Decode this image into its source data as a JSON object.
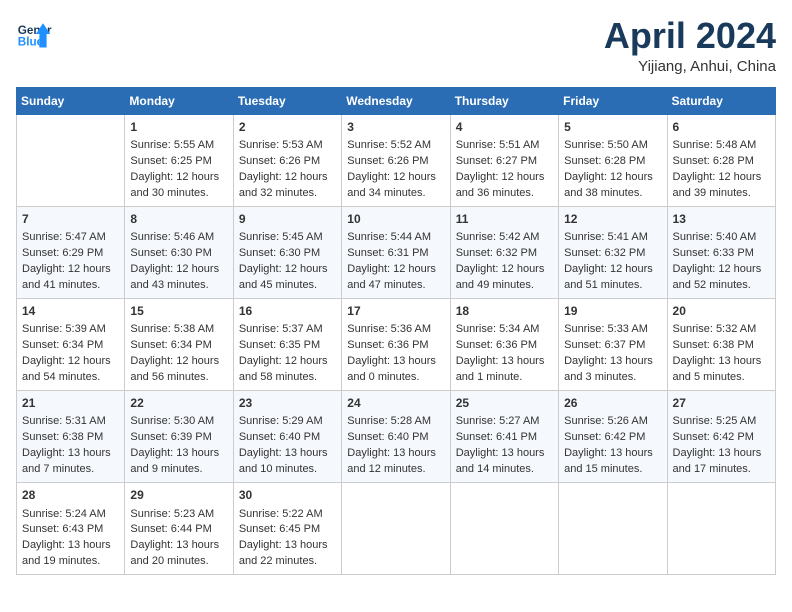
{
  "header": {
    "logo_line1": "General",
    "logo_line2": "Blue",
    "month_title": "April 2024",
    "location": "Yijiang, Anhui, China"
  },
  "days_of_week": [
    "Sunday",
    "Monday",
    "Tuesday",
    "Wednesday",
    "Thursday",
    "Friday",
    "Saturday"
  ],
  "weeks": [
    [
      {
        "day": "",
        "sunrise": "",
        "sunset": "",
        "daylight": ""
      },
      {
        "day": "1",
        "sunrise": "Sunrise: 5:55 AM",
        "sunset": "Sunset: 6:25 PM",
        "daylight": "Daylight: 12 hours and 30 minutes."
      },
      {
        "day": "2",
        "sunrise": "Sunrise: 5:53 AM",
        "sunset": "Sunset: 6:26 PM",
        "daylight": "Daylight: 12 hours and 32 minutes."
      },
      {
        "day": "3",
        "sunrise": "Sunrise: 5:52 AM",
        "sunset": "Sunset: 6:26 PM",
        "daylight": "Daylight: 12 hours and 34 minutes."
      },
      {
        "day": "4",
        "sunrise": "Sunrise: 5:51 AM",
        "sunset": "Sunset: 6:27 PM",
        "daylight": "Daylight: 12 hours and 36 minutes."
      },
      {
        "day": "5",
        "sunrise": "Sunrise: 5:50 AM",
        "sunset": "Sunset: 6:28 PM",
        "daylight": "Daylight: 12 hours and 38 minutes."
      },
      {
        "day": "6",
        "sunrise": "Sunrise: 5:48 AM",
        "sunset": "Sunset: 6:28 PM",
        "daylight": "Daylight: 12 hours and 39 minutes."
      }
    ],
    [
      {
        "day": "7",
        "sunrise": "Sunrise: 5:47 AM",
        "sunset": "Sunset: 6:29 PM",
        "daylight": "Daylight: 12 hours and 41 minutes."
      },
      {
        "day": "8",
        "sunrise": "Sunrise: 5:46 AM",
        "sunset": "Sunset: 6:30 PM",
        "daylight": "Daylight: 12 hours and 43 minutes."
      },
      {
        "day": "9",
        "sunrise": "Sunrise: 5:45 AM",
        "sunset": "Sunset: 6:30 PM",
        "daylight": "Daylight: 12 hours and 45 minutes."
      },
      {
        "day": "10",
        "sunrise": "Sunrise: 5:44 AM",
        "sunset": "Sunset: 6:31 PM",
        "daylight": "Daylight: 12 hours and 47 minutes."
      },
      {
        "day": "11",
        "sunrise": "Sunrise: 5:42 AM",
        "sunset": "Sunset: 6:32 PM",
        "daylight": "Daylight: 12 hours and 49 minutes."
      },
      {
        "day": "12",
        "sunrise": "Sunrise: 5:41 AM",
        "sunset": "Sunset: 6:32 PM",
        "daylight": "Daylight: 12 hours and 51 minutes."
      },
      {
        "day": "13",
        "sunrise": "Sunrise: 5:40 AM",
        "sunset": "Sunset: 6:33 PM",
        "daylight": "Daylight: 12 hours and 52 minutes."
      }
    ],
    [
      {
        "day": "14",
        "sunrise": "Sunrise: 5:39 AM",
        "sunset": "Sunset: 6:34 PM",
        "daylight": "Daylight: 12 hours and 54 minutes."
      },
      {
        "day": "15",
        "sunrise": "Sunrise: 5:38 AM",
        "sunset": "Sunset: 6:34 PM",
        "daylight": "Daylight: 12 hours and 56 minutes."
      },
      {
        "day": "16",
        "sunrise": "Sunrise: 5:37 AM",
        "sunset": "Sunset: 6:35 PM",
        "daylight": "Daylight: 12 hours and 58 minutes."
      },
      {
        "day": "17",
        "sunrise": "Sunrise: 5:36 AM",
        "sunset": "Sunset: 6:36 PM",
        "daylight": "Daylight: 13 hours and 0 minutes."
      },
      {
        "day": "18",
        "sunrise": "Sunrise: 5:34 AM",
        "sunset": "Sunset: 6:36 PM",
        "daylight": "Daylight: 13 hours and 1 minute."
      },
      {
        "day": "19",
        "sunrise": "Sunrise: 5:33 AM",
        "sunset": "Sunset: 6:37 PM",
        "daylight": "Daylight: 13 hours and 3 minutes."
      },
      {
        "day": "20",
        "sunrise": "Sunrise: 5:32 AM",
        "sunset": "Sunset: 6:38 PM",
        "daylight": "Daylight: 13 hours and 5 minutes."
      }
    ],
    [
      {
        "day": "21",
        "sunrise": "Sunrise: 5:31 AM",
        "sunset": "Sunset: 6:38 PM",
        "daylight": "Daylight: 13 hours and 7 minutes."
      },
      {
        "day": "22",
        "sunrise": "Sunrise: 5:30 AM",
        "sunset": "Sunset: 6:39 PM",
        "daylight": "Daylight: 13 hours and 9 minutes."
      },
      {
        "day": "23",
        "sunrise": "Sunrise: 5:29 AM",
        "sunset": "Sunset: 6:40 PM",
        "daylight": "Daylight: 13 hours and 10 minutes."
      },
      {
        "day": "24",
        "sunrise": "Sunrise: 5:28 AM",
        "sunset": "Sunset: 6:40 PM",
        "daylight": "Daylight: 13 hours and 12 minutes."
      },
      {
        "day": "25",
        "sunrise": "Sunrise: 5:27 AM",
        "sunset": "Sunset: 6:41 PM",
        "daylight": "Daylight: 13 hours and 14 minutes."
      },
      {
        "day": "26",
        "sunrise": "Sunrise: 5:26 AM",
        "sunset": "Sunset: 6:42 PM",
        "daylight": "Daylight: 13 hours and 15 minutes."
      },
      {
        "day": "27",
        "sunrise": "Sunrise: 5:25 AM",
        "sunset": "Sunset: 6:42 PM",
        "daylight": "Daylight: 13 hours and 17 minutes."
      }
    ],
    [
      {
        "day": "28",
        "sunrise": "Sunrise: 5:24 AM",
        "sunset": "Sunset: 6:43 PM",
        "daylight": "Daylight: 13 hours and 19 minutes."
      },
      {
        "day": "29",
        "sunrise": "Sunrise: 5:23 AM",
        "sunset": "Sunset: 6:44 PM",
        "daylight": "Daylight: 13 hours and 20 minutes."
      },
      {
        "day": "30",
        "sunrise": "Sunrise: 5:22 AM",
        "sunset": "Sunset: 6:45 PM",
        "daylight": "Daylight: 13 hours and 22 minutes."
      },
      {
        "day": "",
        "sunrise": "",
        "sunset": "",
        "daylight": ""
      },
      {
        "day": "",
        "sunrise": "",
        "sunset": "",
        "daylight": ""
      },
      {
        "day": "",
        "sunrise": "",
        "sunset": "",
        "daylight": ""
      },
      {
        "day": "",
        "sunrise": "",
        "sunset": "",
        "daylight": ""
      }
    ]
  ]
}
